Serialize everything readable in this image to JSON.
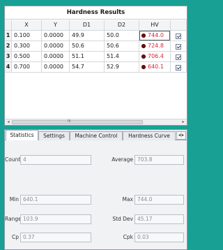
{
  "results": {
    "title": "Hardness Results",
    "columns": [
      "X",
      "Y",
      "D1",
      "D2",
      "HV"
    ],
    "rows": [
      {
        "num": "1",
        "x": "0.100",
        "y": "0.0000",
        "d1": "49.9",
        "d2": "50.0",
        "hv": "744.0",
        "checked": true
      },
      {
        "num": "2",
        "x": "0.300",
        "y": "0.0000",
        "d1": "50.6",
        "d2": "50.6",
        "hv": "724.8",
        "checked": true
      },
      {
        "num": "3",
        "x": "0.500",
        "y": "0.0000",
        "d1": "51.1",
        "d2": "51.4",
        "hv": "706.4",
        "checked": true
      },
      {
        "num": "4",
        "x": "0.700",
        "y": "0.0000",
        "d1": "54.7",
        "d2": "52.9",
        "hv": "640.1",
        "checked": true
      }
    ],
    "scroll_left_icon": "◂",
    "scroll_right_icon": "▸",
    "scroll_grip": "III"
  },
  "tabs": {
    "items": [
      "Statistics",
      "Settings",
      "Machine Control",
      "Hardness Curve"
    ],
    "active": "Statistics",
    "scroll_icon": "◂|▸"
  },
  "statistics": {
    "count_label": "Count",
    "count_value": "4",
    "average_label": "Average",
    "average_value": "703.8",
    "min_label": "Min",
    "min_value": "640.1",
    "max_label": "Max",
    "max_value": "744.0",
    "range_label": "Range",
    "range_value": "103.9",
    "stddev_label": "Std Dev",
    "stddev_value": "45.17",
    "cp_label": "Cp",
    "cp_value": "0.37",
    "cpk_label": "Cpk",
    "cpk_value": "0.03"
  },
  "colors": {
    "background": "#17a093",
    "hv_text": "#d4263d",
    "hv_marker": "#8b0000"
  }
}
